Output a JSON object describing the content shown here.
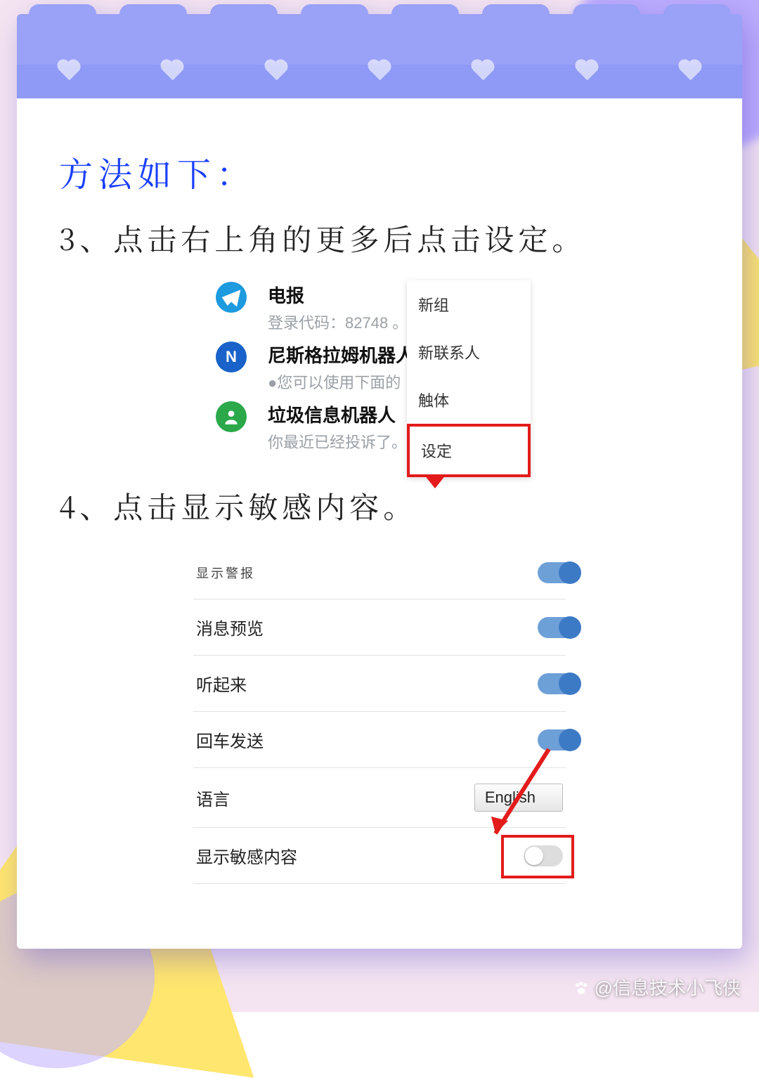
{
  "heading": "方法如下：",
  "step3": "3、点击右上角的更多后点击设定。",
  "step4": "4、点击显示敏感内容。",
  "shot1": {
    "chats": [
      {
        "title": "电报",
        "sub": "登录代码：82748 。"
      },
      {
        "title": "尼斯格拉姆机器人",
        "sub": "●您可以使用下面的"
      },
      {
        "title": "垃圾信息机器人",
        "sub": "你最近已经投诉了。"
      }
    ],
    "menu": [
      "新组",
      "新联系人",
      "触体",
      "设定"
    ]
  },
  "shot2": {
    "rows": [
      {
        "label": "显示警报",
        "type": "toggle_on_partial"
      },
      {
        "label": "消息预览",
        "type": "toggle_on"
      },
      {
        "label": "听起来",
        "type": "toggle_on"
      },
      {
        "label": "回车发送",
        "type": "toggle_on"
      },
      {
        "label": "语言",
        "type": "lang",
        "value": "English"
      },
      {
        "label": "显示敏感内容",
        "type": "toggle_off"
      }
    ]
  },
  "watermark": "@信息技术小飞侠"
}
